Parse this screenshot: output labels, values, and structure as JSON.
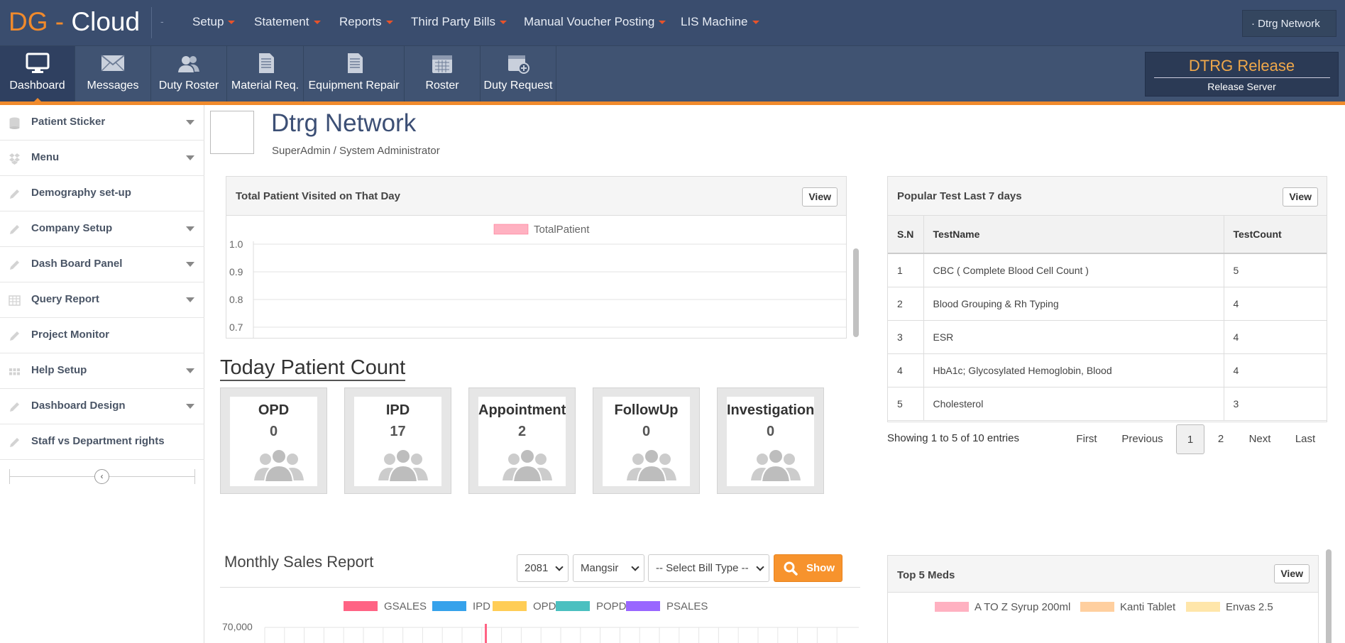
{
  "brand": {
    "dg": "DG",
    "dash": "-",
    "cloud": "Cloud",
    "dot": "-"
  },
  "top_menu": [
    {
      "label": "Setup"
    },
    {
      "label": "Statement"
    },
    {
      "label": "Reports"
    },
    {
      "label": "Third Party Bills"
    },
    {
      "label": "Manual Voucher Posting"
    },
    {
      "label": "LIS Machine"
    }
  ],
  "network_select": {
    "value": "Dtrg Network"
  },
  "toolbar": [
    {
      "label": "Dashboard",
      "icon": "monitor-icon",
      "active": true
    },
    {
      "label": "Messages",
      "icon": "envelope-icon"
    },
    {
      "label": "Duty Roster",
      "icon": "users-icon"
    },
    {
      "label": "Material Req.",
      "icon": "document-icon"
    },
    {
      "label": "Equipment Repair",
      "icon": "document-icon"
    },
    {
      "label": "Roster",
      "icon": "calendar-icon"
    },
    {
      "label": "Duty Request",
      "icon": "calendar-add-icon"
    }
  ],
  "release": {
    "title": "DTRG Release",
    "subtitle": "Release Server"
  },
  "sidebar": {
    "items": [
      {
        "label": "Patient Sticker",
        "icon": "cylinder-icon",
        "expandable": true
      },
      {
        "label": "Menu",
        "icon": "dropbox-icon",
        "expandable": true
      },
      {
        "label": "Demography set-up",
        "icon": "pencil-icon",
        "expandable": false
      },
      {
        "label": "Company Setup",
        "icon": "pencil-icon",
        "expandable": true
      },
      {
        "label": "Dash Board Panel",
        "icon": "pencil-icon",
        "expandable": true
      },
      {
        "label": "Query Report",
        "icon": "table-icon",
        "expandable": true
      },
      {
        "label": "Project Monitor",
        "icon": "pencil-icon",
        "expandable": false
      },
      {
        "label": "Help Setup",
        "icon": "grid-icon",
        "expandable": true
      },
      {
        "label": "Dashboard Design",
        "icon": "pencil-icon",
        "expandable": true
      },
      {
        "label": "Staff vs Department rights",
        "icon": "pencil-icon",
        "expandable": false
      }
    ],
    "collapse_icon": "chevron-left-icon"
  },
  "header": {
    "org_name": "Dtrg Network",
    "role": "SuperAdmin / System Administrator"
  },
  "patient_chart": {
    "title": "Total Patient Visited on That Day",
    "view_label": "View"
  },
  "today": {
    "title": "Today Patient Count",
    "cards": [
      {
        "name": "OPD",
        "value": "0"
      },
      {
        "name": "IPD",
        "value": "17"
      },
      {
        "name": "Appointment",
        "value": "2"
      },
      {
        "name": "FollowUp",
        "value": "0"
      },
      {
        "name": "Investigation",
        "value": "0"
      }
    ]
  },
  "popular": {
    "title": "Popular Test Last 7 days",
    "view_label": "View",
    "columns": [
      "S.N",
      "TestName",
      "TestCount"
    ],
    "rows": [
      [
        "1",
        "CBC ( Complete Blood Cell Count )",
        "5"
      ],
      [
        "2",
        "Blood Grouping & Rh Typing",
        "4"
      ],
      [
        "3",
        "ESR",
        "4"
      ],
      [
        "4",
        "HbA1c; Glycosylated Hemoglobin, Blood",
        "4"
      ],
      [
        "5",
        "Cholesterol",
        "3"
      ]
    ],
    "info": "Showing 1 to 5 of 10 entries",
    "pagination": {
      "first": "First",
      "previous": "Previous",
      "page1": "1",
      "page2": "2",
      "next": "Next",
      "last": "Last"
    }
  },
  "sales": {
    "title": "Monthly Sales Report",
    "year": "2081",
    "month": "Mangsir",
    "bill_type_placeholder": "-- Select Bill Type --",
    "show_label": "Show"
  },
  "meds": {
    "title": "Top 5 Meds",
    "view_label": "View",
    "legend": [
      {
        "name": "A TO Z Syrup 200ml",
        "color": "#ffb1c1"
      },
      {
        "name": "Kanti Tablet",
        "color": "#ffcf9f"
      },
      {
        "name": "Envas 2.5",
        "color": "#ffe6aa"
      }
    ]
  },
  "chart_data": [
    {
      "type": "line",
      "legend_position": "top",
      "series": [
        {
          "name": "TotalPatient",
          "color": "#ffb1c1",
          "values": []
        }
      ],
      "yticks": [
        "1.0",
        "0.9",
        "0.8",
        "0.7"
      ],
      "ylim": [
        0.7,
        1.0
      ],
      "grid": true
    },
    {
      "type": "bar",
      "legend_position": "top",
      "series": [
        {
          "name": "GSALES",
          "color": "#ff6384",
          "values": []
        },
        {
          "name": "IPD",
          "color": "#36a2eb",
          "values": []
        },
        {
          "name": "OPD",
          "color": "#ffcd56",
          "values": []
        },
        {
          "name": "POPD",
          "color": "#4bc0c0",
          "values": []
        },
        {
          "name": "PSALES",
          "color": "#9966ff",
          "values": []
        }
      ],
      "yticks": [
        "70,000"
      ],
      "grid": true
    }
  ]
}
